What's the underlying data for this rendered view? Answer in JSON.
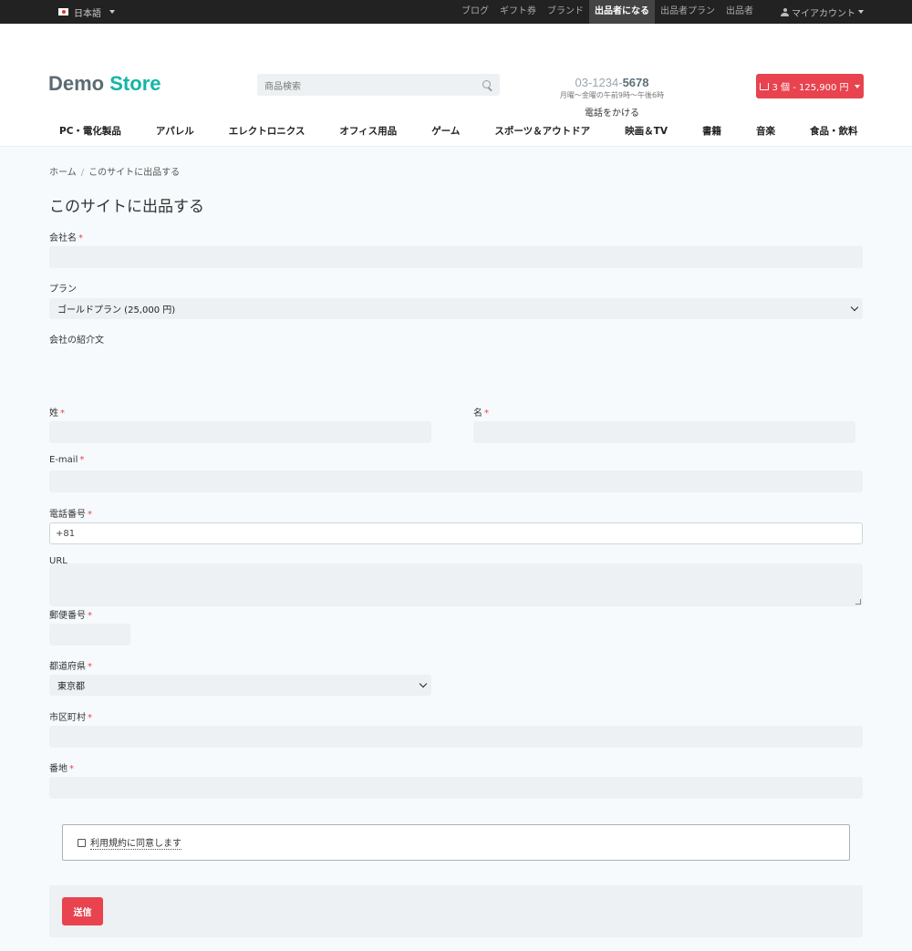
{
  "topbar": {
    "language": "日本語",
    "links": [
      "ブログ",
      "ギフト券",
      "ブランド",
      "出品者になる",
      "出品者プラン",
      "出品者"
    ],
    "active_index": 3,
    "account": "マイアカウント"
  },
  "header": {
    "logo_part1": "Demo",
    "logo_part2": "Store",
    "search_placeholder": "商品検索",
    "phone_prefix": "03-1234-",
    "phone_suffix": "5678",
    "hours": "月曜〜金曜の午前9時〜午後6時",
    "call_label": "電話をかける",
    "cart_label": "3 個 - 125,900 円"
  },
  "nav": [
    "PC・電化製品",
    "アパレル",
    "エレクトロニクス",
    "オフィス用品",
    "ゲーム",
    "スポーツ＆アウトドア",
    "映画＆TV",
    "書籍",
    "音楽",
    "食品・飲料"
  ],
  "breadcrumb": {
    "home": "ホーム",
    "separator": "/",
    "current": "このサイトに出品する"
  },
  "page_title": "このサイトに出品する",
  "form": {
    "company_label": "会社名",
    "plan_label": "プラン",
    "plan_value": "ゴールドプラン (25,000 円)",
    "intro_label": "会社の紹介文",
    "last_name_label": "姓",
    "first_name_label": "名",
    "email_label": "E-mail",
    "phone_label": "電話番号",
    "phone_value": "+81",
    "url_label": "URL",
    "zip_label": "郵便番号",
    "prefecture_label": "都道府県",
    "prefecture_value": "東京都",
    "city_label": "市区町村",
    "address_label": "番地",
    "required_mark": "*",
    "terms_label": "利用規約に同意します",
    "submit_label": "送信"
  },
  "colors": {
    "accent": "#e8434e",
    "logo_teal": "#15b5a6",
    "topbar_bg": "#222222"
  }
}
